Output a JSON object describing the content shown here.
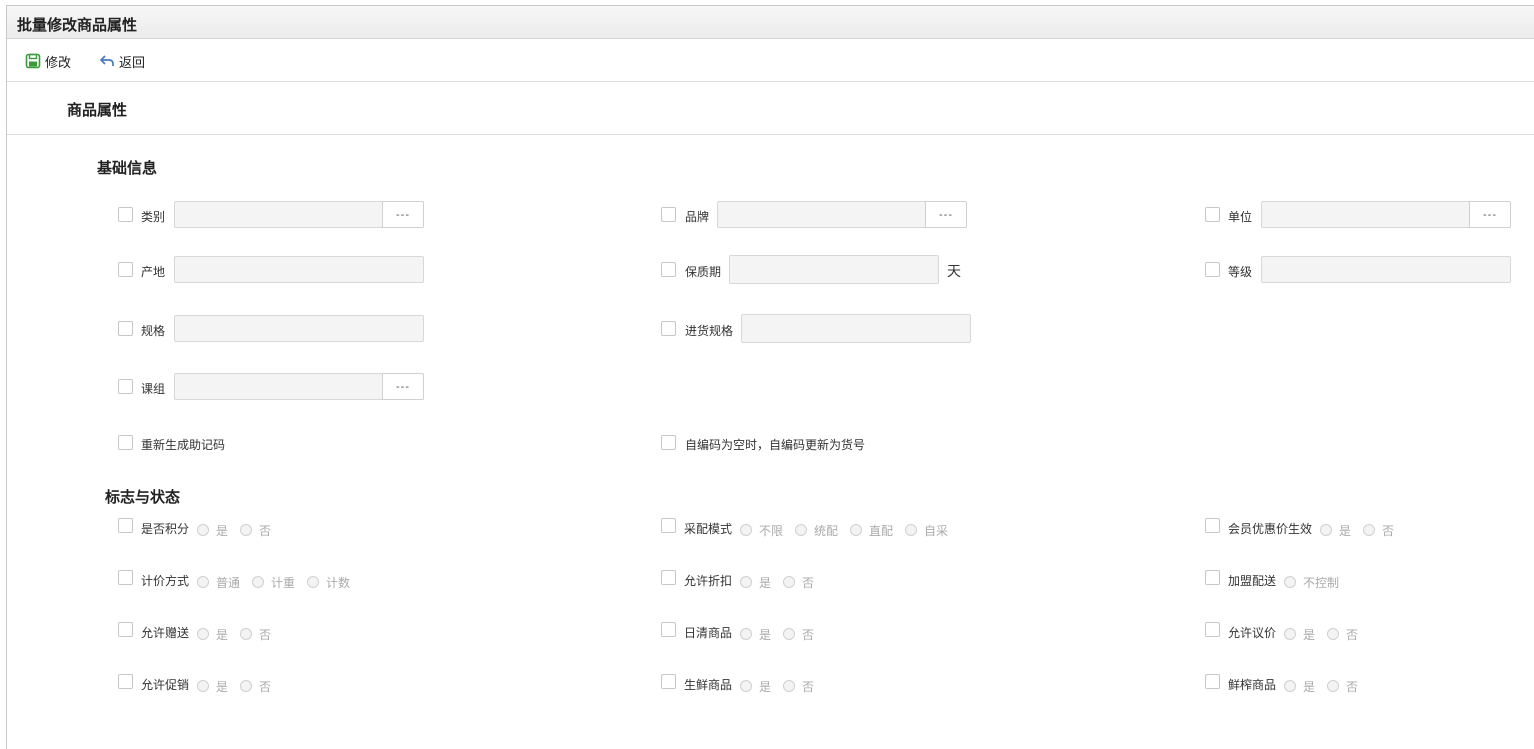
{
  "window": {
    "title": "批量修改商品属性"
  },
  "toolbar": {
    "save_label": "修改",
    "back_label": "返回"
  },
  "section": {
    "title": "商品属性"
  },
  "basic": {
    "title": "基础信息",
    "category": "类别",
    "brand": "品牌",
    "unit": "单位",
    "origin": "产地",
    "shelf_life": "保质期",
    "shelf_life_unit": "天",
    "grade": "等级",
    "spec": "规格",
    "purchase_spec": "进货规格",
    "course_group": "课组",
    "dots": "---",
    "regen_code": "重新生成助记码",
    "self_code": "自编码为空时，自编码更新为货号"
  },
  "flags": {
    "title": "标志与状态",
    "rows": [
      {
        "label": "是否积分",
        "options": [
          "是",
          "否"
        ]
      },
      {
        "label": "采配模式",
        "options": [
          "不限",
          "统配",
          "直配",
          "自采"
        ]
      },
      {
        "label": "会员优惠价生效",
        "options": [
          "是",
          "否"
        ]
      },
      {
        "label": "计价方式",
        "options": [
          "普通",
          "计重",
          "计数"
        ]
      },
      {
        "label": "允许折扣",
        "options": [
          "是",
          "否"
        ]
      },
      {
        "label": "加盟配送",
        "options": [
          "不控制"
        ]
      },
      {
        "label": "允许赠送",
        "options": [
          "是",
          "否"
        ]
      },
      {
        "label": "日清商品",
        "options": [
          "是",
          "否"
        ]
      },
      {
        "label": "允许议价",
        "options": [
          "是",
          "否"
        ]
      },
      {
        "label": "允许促销",
        "options": [
          "是",
          "否"
        ]
      },
      {
        "label": "生鲜商品",
        "options": [
          "是",
          "否"
        ]
      },
      {
        "label": "鲜榨商品",
        "options": [
          "是",
          "否"
        ]
      }
    ]
  },
  "colors": {
    "save_icon": "#3a9a3a",
    "back_icon": "#4a7bc0"
  }
}
